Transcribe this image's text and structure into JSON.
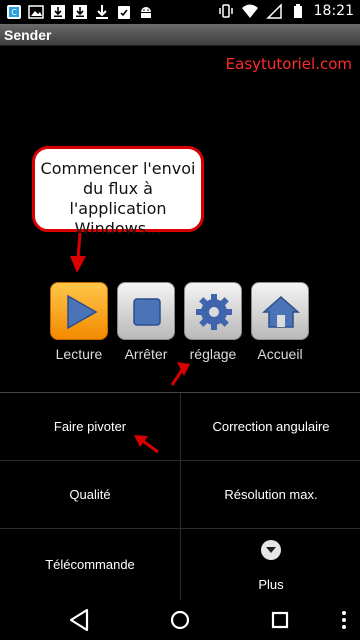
{
  "status_bar": {
    "time": "18:21",
    "left_icons": [
      "app-icon",
      "image-icon",
      "download-icon",
      "download-icon",
      "download-icon",
      "clipboard-icon",
      "android-icon"
    ],
    "right_icons": [
      "vibrate-icon",
      "wifi-icon",
      "no-sim-icon",
      "battery-icon"
    ]
  },
  "title_bar": {
    "title": "Sender"
  },
  "watermark": "Easytutoriel.com",
  "callout": {
    "lines": [
      "Commencer l'envoi",
      "du flux à l'application",
      "Windows..."
    ]
  },
  "toolbar": {
    "items": [
      {
        "label": "Lecture",
        "icon": "play-icon"
      },
      {
        "label": "Arrêter",
        "icon": "stop-icon"
      },
      {
        "label": "réglage",
        "icon": "gear-icon"
      },
      {
        "label": "Accueil",
        "icon": "home-icon"
      }
    ]
  },
  "menu": {
    "items": [
      {
        "label": "Faire pivoter"
      },
      {
        "label": "Correction angulaire"
      },
      {
        "label": "Qualité"
      },
      {
        "label": "Résolution max."
      },
      {
        "label": "Télécommande"
      },
      {
        "label": "Plus",
        "icon": "chevron-down-circle-icon"
      }
    ]
  },
  "nav_bar": {
    "items": [
      "back-icon",
      "home-circle-icon",
      "recents-icon",
      "overflow-menu-icon"
    ]
  },
  "colors": {
    "annotation_red": "#d80000",
    "play_orange": "#f38a00"
  }
}
